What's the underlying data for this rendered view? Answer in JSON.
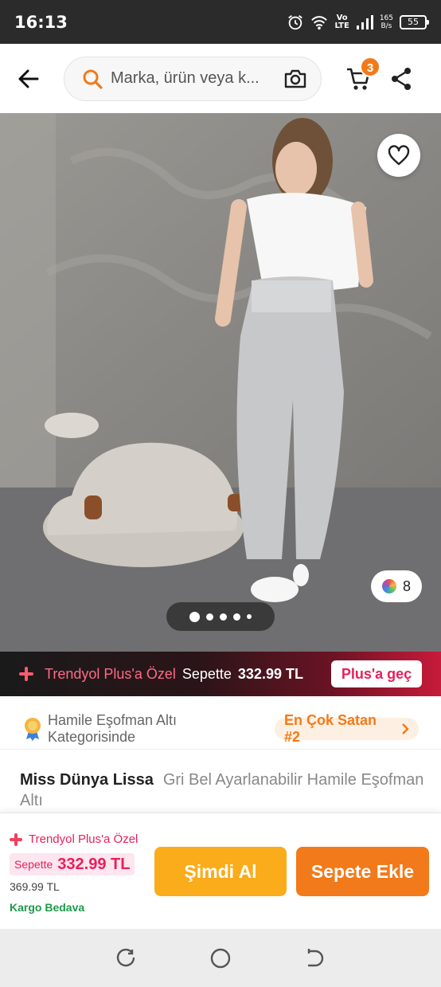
{
  "status_bar": {
    "time": "16:13",
    "volte_top": "Vo",
    "volte_bottom": "LTE",
    "net_speed_value": "165",
    "net_speed_unit": "B/s",
    "battery": "55"
  },
  "top_bar": {
    "search_placeholder": "Marka, ürün veya k...",
    "cart_count": "3"
  },
  "hero": {
    "color_options_count": "8",
    "pager": {
      "total": 5,
      "active_index": 0
    }
  },
  "plus_banner": {
    "title": "Trendyol Plus'a Özel",
    "cart_text": "Sepette",
    "price": "332.99 TL",
    "button_label": "Plus'a geç"
  },
  "category": {
    "text": "Hamile Eşofman Altı Kategorisinde",
    "badge": "En Çok Satan #2"
  },
  "product": {
    "brand": "Miss Dünya Lissa",
    "name": "Gri Bel Ayarlanabilir Hamile Eşofman Altı"
  },
  "buy_bar": {
    "plus_label": "Trendyol Plus'a Özel",
    "sepette_label": "Sepette",
    "price": "332.99 TL",
    "old_price": "369.99 TL",
    "shipping": "Kargo Bedava",
    "buy_now_label": "Şimdi Al",
    "add_to_cart_label": "Sepete Ekle"
  },
  "colors": {
    "accent": "#f27a1a",
    "buy_now": "#fbac1b",
    "plus_pink": "#e8205a",
    "shipping_green": "#1a9b48"
  }
}
